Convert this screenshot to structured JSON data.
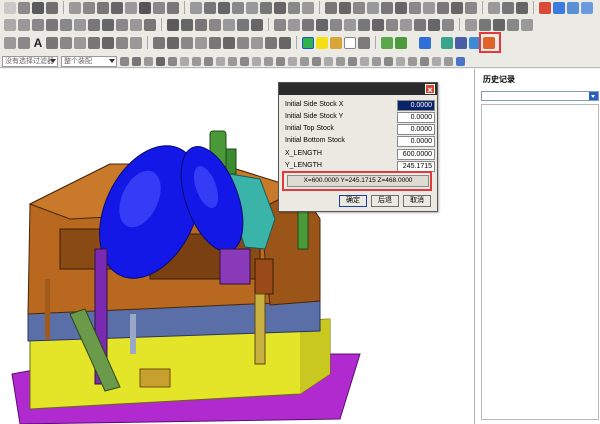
{
  "toolbar": {
    "text_tool_icon": "A",
    "highlighted_button_icon": "stock-size-icon"
  },
  "filters": {
    "selection_filter": "没有选择过滤器",
    "scope": "整个装配"
  },
  "dialog": {
    "fields": [
      {
        "label": "Initial Side Stock X",
        "value": "0.0000"
      },
      {
        "label": "Initial Side Stock Y",
        "value": "0.0000"
      },
      {
        "label": "Initial Top Stock",
        "value": "0.0000"
      },
      {
        "label": "Initial Bottom Stock",
        "value": "0.0000"
      },
      {
        "label": "X_LENGTH",
        "value": "600.0000"
      },
      {
        "label": "Y_LENGTH",
        "value": "245.1715"
      }
    ],
    "coordinates": "X=600.0000 Y=245.1715 Z=468.0000",
    "ok_label": "确定",
    "back_label": "后退",
    "cancel_label": "取消",
    "close_symbol": "×"
  },
  "history_panel": {
    "title": "历史记录"
  },
  "colors": {
    "highlight": "#e23a3a",
    "toolbar_bg": "#eceae4",
    "mold_blue": "#1418e6",
    "mold_brown": "#b8681f",
    "base_yellow": "#e6e629"
  }
}
